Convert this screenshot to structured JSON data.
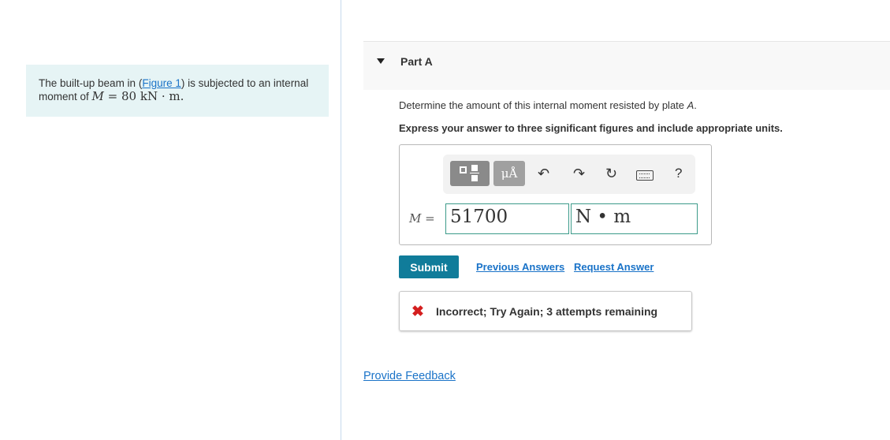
{
  "problem": {
    "text_before": "The built-up beam in (",
    "figure_link": "Figure 1",
    "text_after": ") is subjected to an internal moment of ",
    "math_var": "M",
    "math_rest": " = 80 kN · m."
  },
  "part": {
    "title": "Part A",
    "question_text": "Determine the amount of this internal moment resisted by plate ",
    "question_var": "A",
    "question_end": ".",
    "instruction": "Express your answer to three significant figures and include appropriate units."
  },
  "toolbar": {
    "units_button": "μÅ",
    "undo_icon": "↶",
    "redo_icon": "↷",
    "reset_icon": "↻",
    "help_label": "?"
  },
  "answer": {
    "var_label": "M",
    "equals": " = ",
    "value": "51700",
    "units": "N • m"
  },
  "actions": {
    "submit_label": "Submit",
    "previous_answers": "Previous Answers",
    "request_answer": "Request Answer"
  },
  "feedback": {
    "icon": "✖",
    "message": "Incorrect; Try Again; 3 attempts remaining"
  },
  "footer": {
    "provide_feedback": "Provide Feedback"
  },
  "colors": {
    "accent": "#107c9a",
    "link": "#1a73c8",
    "error": "#d41e1e",
    "problem_bg": "#e6f4f5"
  }
}
